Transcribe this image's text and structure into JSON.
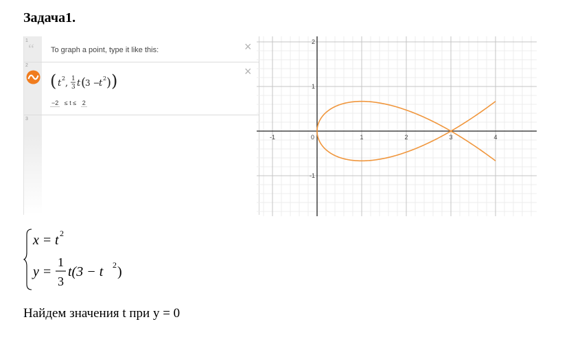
{
  "heading": "Задача1.",
  "panel": {
    "row_numbers": [
      "1",
      "2",
      "3"
    ],
    "note": "To graph a point, type it like this:",
    "close_glyph": "×",
    "domain": {
      "lower": "−2",
      "relation": "≤ t ≤",
      "upper": "2"
    }
  },
  "graph": {
    "x_ticks": [
      "-1",
      "0",
      "1",
      "2",
      "3",
      "4"
    ],
    "y_ticks": [
      "2",
      "1",
      "-1"
    ],
    "curve_color": "#f0963c"
  },
  "system": {
    "eq1_lhs": "x",
    "eq1_rhs": "t",
    "eq1_exp": "2",
    "eq2_lhs": "y",
    "eq2_num": "1",
    "eq2_den": "3",
    "eq2_tail": "t(3 − t",
    "eq2_exp": "2",
    "eq2_close": ")"
  },
  "find_text": "Найдем значения t при y = 0"
}
